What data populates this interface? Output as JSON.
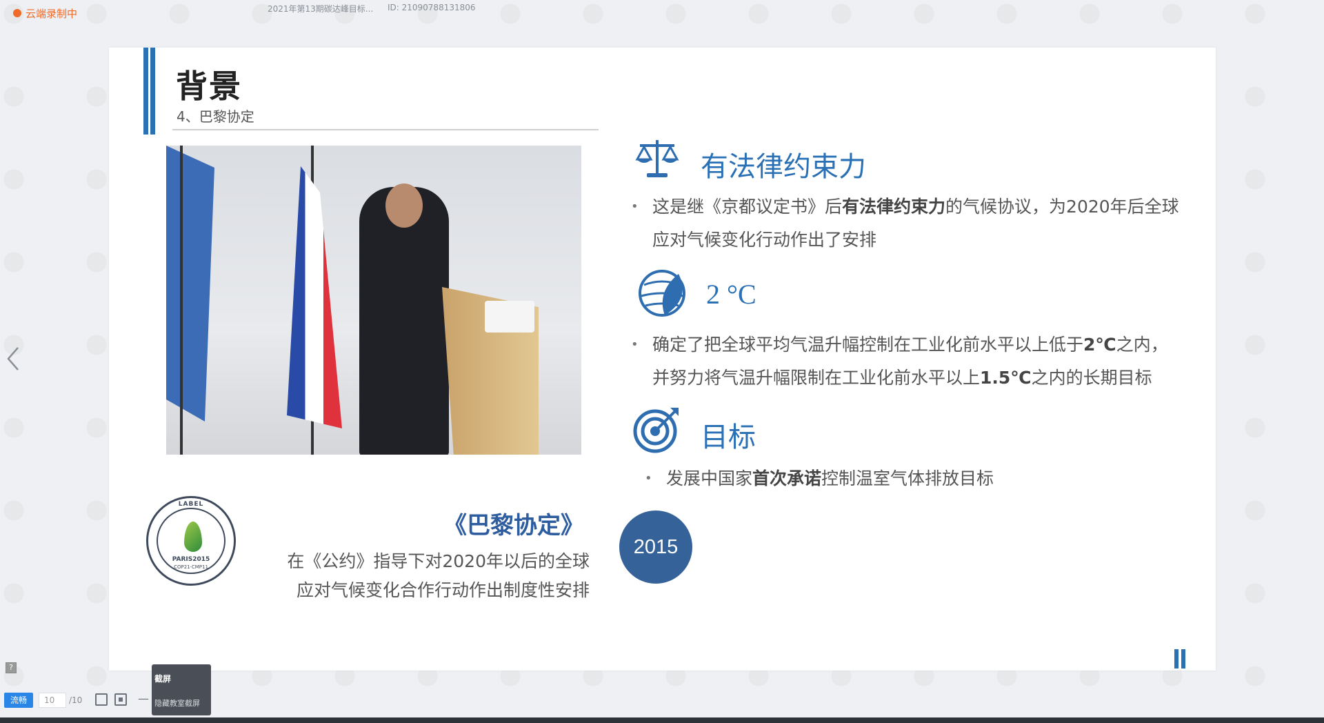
{
  "top_bar": {
    "recording_status": "云端录制中",
    "course_title": "2021年第13期碳达峰目标...",
    "course_id": "ID: 21090788131806"
  },
  "slide": {
    "title": "背景",
    "subtitle": "4、巴黎协定",
    "sections": [
      {
        "icon": "scale-icon",
        "heading": "有法律约束力",
        "bullet_pre": "这是继《京都议定书》后",
        "bullet_bold": "有法律约束力",
        "bullet_post_line1": "的气候协议，为2020年后全球",
        "bullet_line2": "应对气候变化行动作出了安排"
      },
      {
        "icon": "globe-leaf-icon",
        "heading": "2 °C",
        "line1_pre": "确定了把全球平均气温升幅控制在工业化前水平以上低于",
        "line1_bold": "2℃",
        "line1_post": "之内，",
        "line2_pre": "并努力将气温升幅限制在工业化前水平以上",
        "line2_bold": "1.5℃",
        "line2_post": "之内的长期目标"
      },
      {
        "icon": "target-icon",
        "heading": "目标",
        "bullet_pre": "发展中国家",
        "bullet_bold": "首次承诺",
        "bullet_post": "控制温室气体排放目标"
      }
    ],
    "paris_heading": "《巴黎协定》",
    "paris_desc_line1": "在《公约》指导下对2020年以后的全球",
    "paris_desc_line2": "应对气候变化合作行动作出制度性安排",
    "year": "2015",
    "logo": {
      "label": "LABEL",
      "text": "PARIS2015",
      "subtext": "COP21·CMP11"
    }
  },
  "toolbar": {
    "stream_label": "流畅",
    "page_current": "10",
    "page_total": "/10",
    "minus": "—"
  },
  "tooltip": {
    "title": "截屏",
    "subtitle": "隐藏教室截屏"
  },
  "colors": {
    "accent_blue": "#2a70b4",
    "recording_orange": "#f06a2a",
    "year_circle": "#356299"
  }
}
